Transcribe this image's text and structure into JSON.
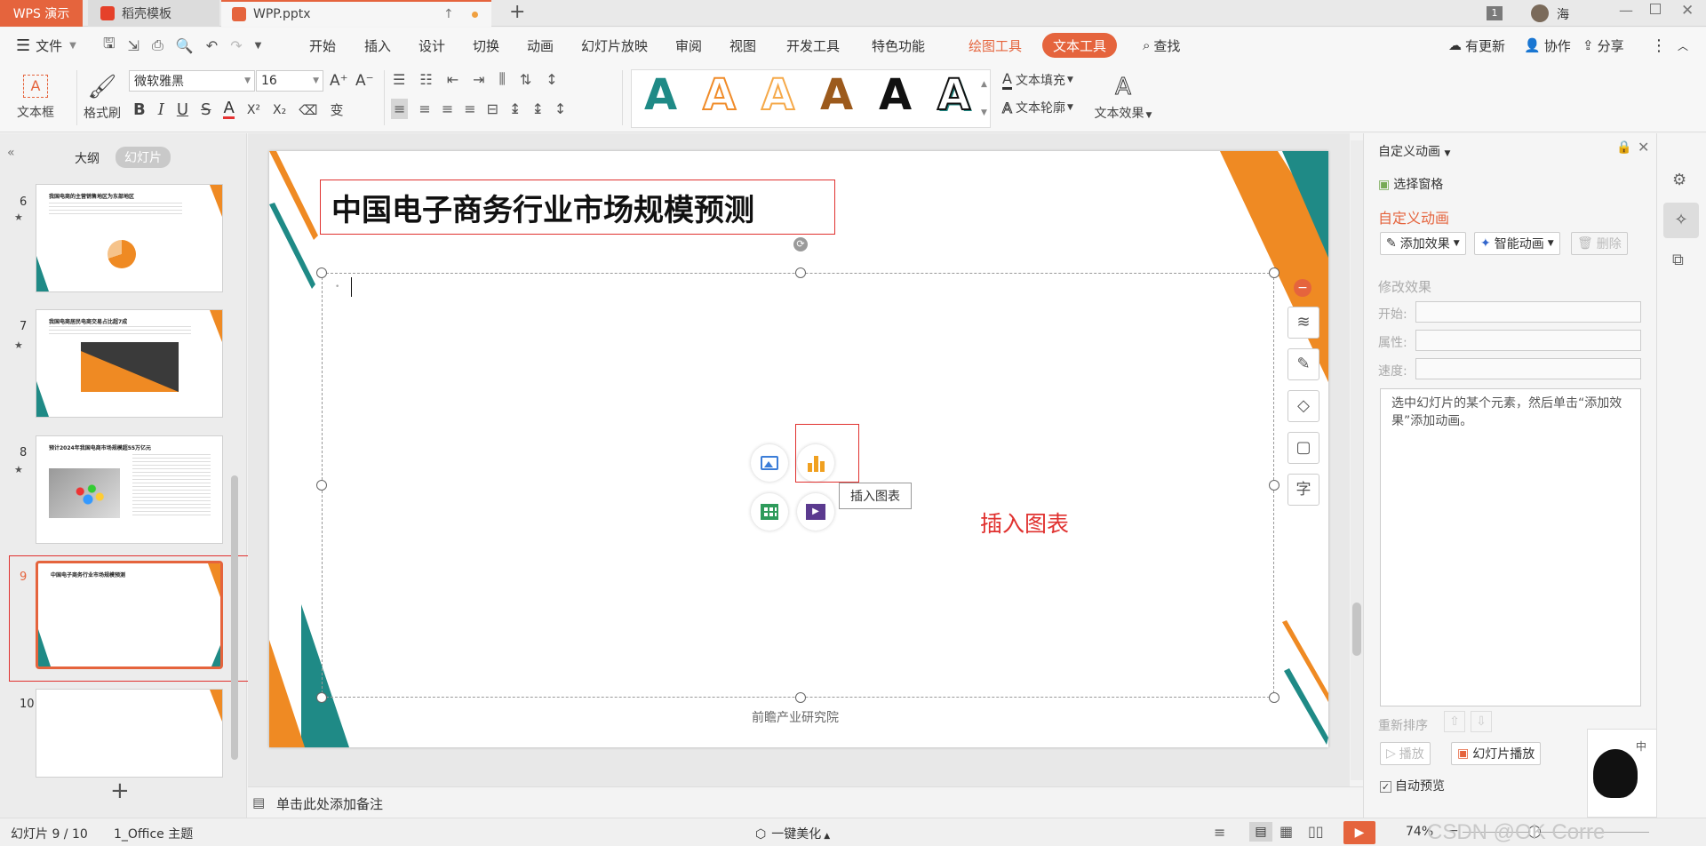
{
  "titlebar": {
    "app_tab": "WPS 演示",
    "tabs": [
      {
        "label": "稻壳模板"
      },
      {
        "label": "WPP.pptx"
      }
    ],
    "badge": "1",
    "user": "海"
  },
  "menubar": {
    "file": "文件",
    "items": [
      "开始",
      "插入",
      "设计",
      "切换",
      "动画",
      "幻灯片放映",
      "审阅",
      "视图",
      "开发工具",
      "特色功能"
    ],
    "drawing_tools": "绘图工具",
    "text_tools": "文本工具",
    "search": "查找",
    "update": "有更新",
    "collab": "协作",
    "share": "分享"
  },
  "ribbon": {
    "textbox": "文本框",
    "format_painter": "格式刷",
    "font_name": "微软雅黑",
    "font_size": "16",
    "text_fill": "文本填充",
    "text_outline": "文本轮廓",
    "text_effect": "文本效果",
    "style_letter": "A",
    "style_colors": [
      "#1f8a86",
      "#f08c2a",
      "#f5a94a",
      "#9c5a1c",
      "#111111",
      "#1f8a86"
    ]
  },
  "leftpanel": {
    "tab_outline": "大纲",
    "tab_slides": "幻灯片",
    "slides": [
      {
        "num": "6",
        "title": "我国电商的主营销售地区为东部地区"
      },
      {
        "num": "7",
        "title": "我国电商居民电商交易占比超7成"
      },
      {
        "num": "8",
        "title": "预计2024年我国电商市场规模超55万亿元"
      },
      {
        "num": "9",
        "title": "中国电子商务行业市场规模预测"
      },
      {
        "num": "10",
        "title": ""
      }
    ]
  },
  "slide": {
    "title": "中国电子商务行业市场规模预测",
    "footer": "前瞻产业研究院",
    "insert_chart_tooltip": "插入图表",
    "annotation": "插入图表"
  },
  "notes": {
    "placeholder": "单击此处添加备注"
  },
  "rightpanel": {
    "title": "自定义动画",
    "selection_pane": "选择窗格",
    "section": "自定义动画",
    "add_effect": "添加效果",
    "smart_anim": "智能动画",
    "delete": "删除",
    "modify": "修改效果",
    "start": "开始:",
    "property": "属性:",
    "speed": "速度:",
    "hint": "选中幻灯片的某个元素，然后单击“添加效果”添加动画。",
    "reorder": "重新排序",
    "play": "播放",
    "slideshow": "幻灯片播放",
    "autopreview": "自动预览"
  },
  "statusbar": {
    "slide_info": "幻灯片 9 / 10",
    "theme": "1_Office 主题",
    "beautify": "一键美化",
    "zoom": "74%",
    "watermark": "CSDN @OK Corre"
  },
  "colors": {
    "accent": "#e5643d",
    "orange": "#ef8a23",
    "teal": "#1f8a86",
    "annotation_red": "#e0312f"
  }
}
